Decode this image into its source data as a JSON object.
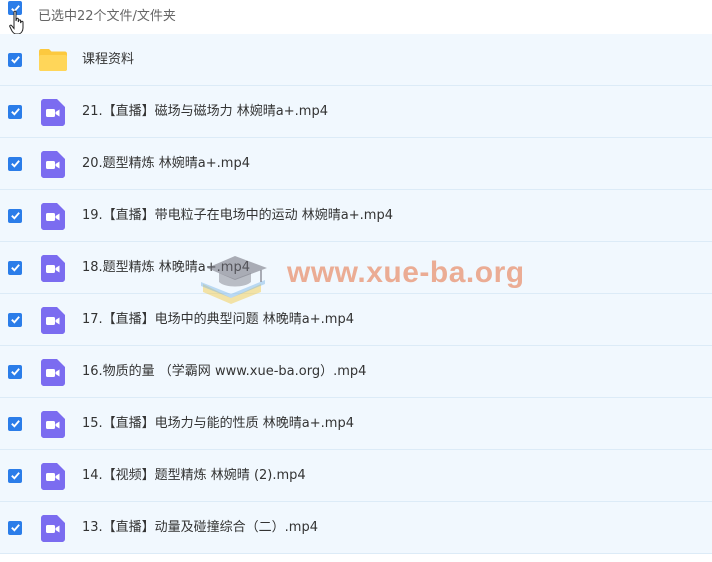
{
  "header": {
    "selection_text": "已选中22个文件/文件夹"
  },
  "files": [
    {
      "type": "folder",
      "name": "课程资料"
    },
    {
      "type": "video",
      "name": "21.【直播】磁场与磁场力 林婉晴a+.mp4"
    },
    {
      "type": "video",
      "name": "20.题型精炼 林婉晴a+.mp4"
    },
    {
      "type": "video",
      "name": "19.【直播】带电粒子在电场中的运动 林婉晴a+.mp4"
    },
    {
      "type": "video",
      "name": "18.题型精炼 林晚晴a+.mp4"
    },
    {
      "type": "video",
      "name": "17.【直播】电场中的典型问题 林晚晴a+.mp4"
    },
    {
      "type": "video",
      "name": "16.物质的量 （学霸网 www.xue-ba.org）.mp4"
    },
    {
      "type": "video",
      "name": "15.【直播】电场力与能的性质 林晚晴a+.mp4"
    },
    {
      "type": "video",
      "name": "14.【视频】题型精炼 林婉晴 (2).mp4"
    },
    {
      "type": "video",
      "name": "13.【直播】动量及碰撞综合（二）.mp4"
    }
  ],
  "watermark": {
    "text": "www.xue-ba.org"
  },
  "colors": {
    "checkbox": "#2b7de9",
    "row_bg": "#f1f8fe",
    "video_icon": "#7b6cf0",
    "folder_icon": "#fcc93f"
  }
}
